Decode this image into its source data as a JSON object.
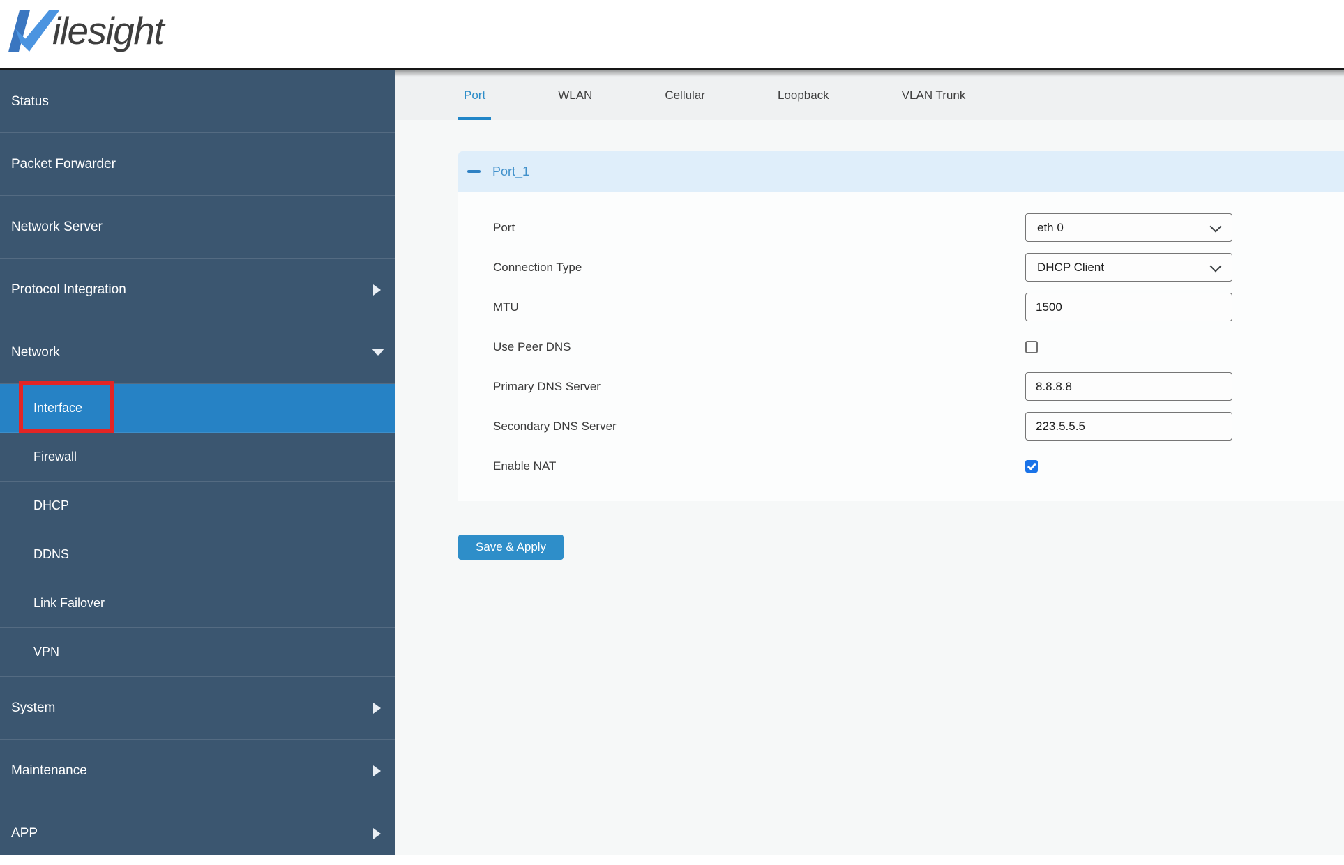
{
  "logo": {
    "brand_mark": "milesight-m-check",
    "brand_text": "ilesight"
  },
  "sidebar": {
    "items": [
      {
        "label": "Status"
      },
      {
        "label": "Packet Forwarder"
      },
      {
        "label": "Network Server"
      },
      {
        "label": "Protocol Integration",
        "arrow": "right"
      },
      {
        "label": "Network",
        "arrow": "down",
        "expanded": true
      },
      {
        "label": "Interface",
        "sub": true,
        "active": true,
        "annotated": true
      },
      {
        "label": "Firewall",
        "sub": true
      },
      {
        "label": "DHCP",
        "sub": true
      },
      {
        "label": "DDNS",
        "sub": true
      },
      {
        "label": "Link Failover",
        "sub": true
      },
      {
        "label": "VPN",
        "sub": true
      },
      {
        "label": "System",
        "arrow": "right"
      },
      {
        "label": "Maintenance",
        "arrow": "right"
      },
      {
        "label": "APP",
        "arrow": "right"
      }
    ]
  },
  "tabs": [
    {
      "label": "Port",
      "active": true
    },
    {
      "label": "WLAN",
      "active": false
    },
    {
      "label": "Cellular",
      "active": false
    },
    {
      "label": "Loopback",
      "active": false
    },
    {
      "label": "VLAN Trunk",
      "active": false
    }
  ],
  "panel": {
    "title": "Port_1",
    "collapse_icon": "minus-icon",
    "collapsed": false
  },
  "form": {
    "fields": [
      {
        "label": "Port",
        "control": "select",
        "value": "eth 0"
      },
      {
        "label": "Connection Type",
        "control": "select",
        "value": "DHCP Client"
      },
      {
        "label": "MTU",
        "control": "input",
        "value": "1500"
      },
      {
        "label": "Use Peer DNS",
        "control": "checkbox",
        "checked": false
      },
      {
        "label": "Primary DNS Server",
        "control": "input",
        "value": "8.8.8.8"
      },
      {
        "label": "Secondary DNS Server",
        "control": "input",
        "value": "223.5.5.5"
      },
      {
        "label": "Enable NAT",
        "control": "checkbox",
        "checked": true
      }
    ]
  },
  "actions": {
    "save_label": "Save & Apply"
  },
  "colors": {
    "sidebar_bg": "#3b5670",
    "sidebar_active": "#2682c5",
    "annotation_red": "#e32525",
    "tab_active_blue": "#2b8cc8",
    "panel_band_bg": "#dfeefa",
    "panel_title_blue": "#4191cb",
    "button_blue": "#2e8ec9",
    "checkbox_checked_blue": "#1a73e8",
    "logo_dark_blue": "#3a76c0",
    "logo_light_blue": "#4b94e0"
  }
}
